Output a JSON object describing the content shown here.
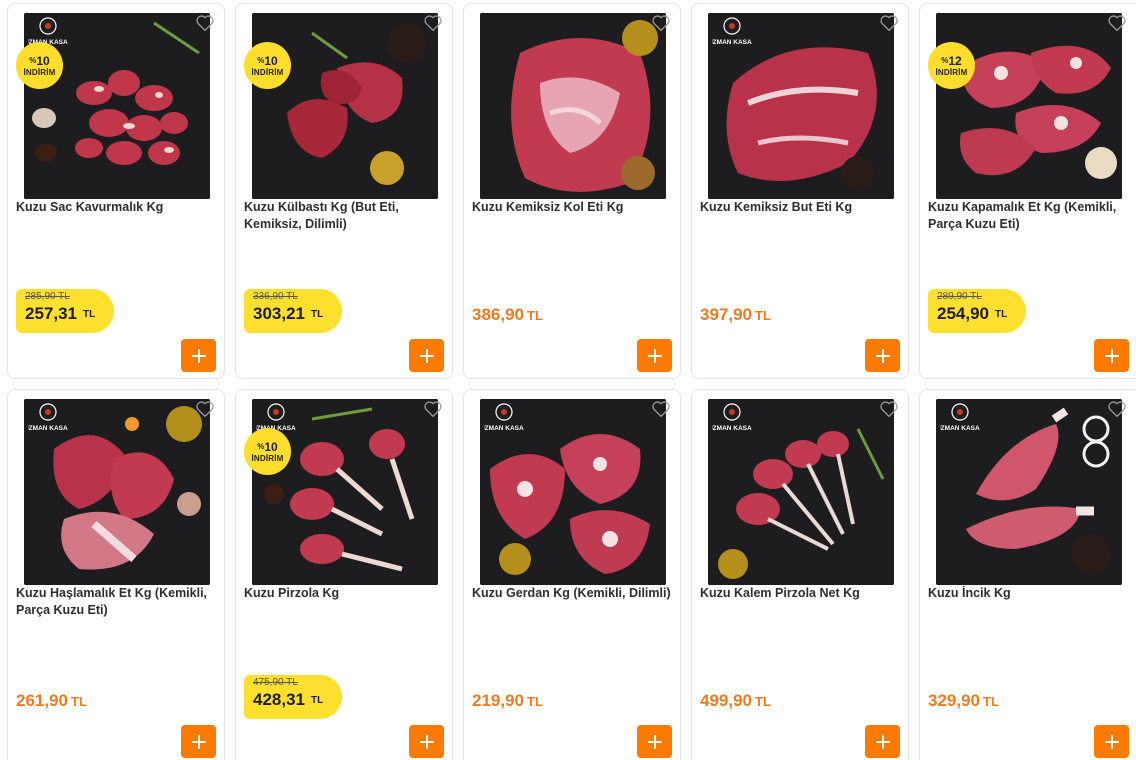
{
  "colors": {
    "accent": "#ff7a00",
    "price": "#f47a1f",
    "badge": "#ffde2b",
    "border": "#e3e3e3"
  },
  "badge_label": "İNDİRİM",
  "currency": "TL",
  "brand_logo_text": "UZMAN KASAP",
  "products": [
    {
      "name": "Kuzu Sac Kavurmalık Kg",
      "discount_pct": "10",
      "old_price": "285,90 TL",
      "price": "257,31"
    },
    {
      "name": "Kuzu Külbastı Kg (But Eti, Kemiksiz, Dilimli)",
      "discount_pct": "10",
      "old_price": "336,90 TL",
      "price": "303,21"
    },
    {
      "name": "Kuzu Kemiksiz Kol Eti Kg",
      "price": "386,90"
    },
    {
      "name": "Kuzu Kemiksiz But Eti Kg",
      "price": "397,90"
    },
    {
      "name": "Kuzu Kapamalık Et Kg (Kemikli, Parça Kuzu Eti)",
      "discount_pct": "12",
      "old_price": "289,90 TL",
      "price": "254,90"
    },
    {
      "name": "Kuzu Haşlamalık Et Kg (Kemikli, Parça Kuzu Eti)",
      "price": "261,90"
    },
    {
      "name": "Kuzu Pirzola Kg",
      "discount_pct": "10",
      "old_price": "475,90 TL",
      "price": "428,31"
    },
    {
      "name": "Kuzu Gerdan Kg (Kemikli, Dilimli)",
      "price": "219,90"
    },
    {
      "name": "Kuzu Kalem Pirzola Net Kg",
      "price": "499,90"
    },
    {
      "name": "Kuzu İncik Kg",
      "price": "329,90"
    }
  ],
  "icons": {
    "favorite": "heart-outline-icon",
    "add": "plus-icon"
  }
}
